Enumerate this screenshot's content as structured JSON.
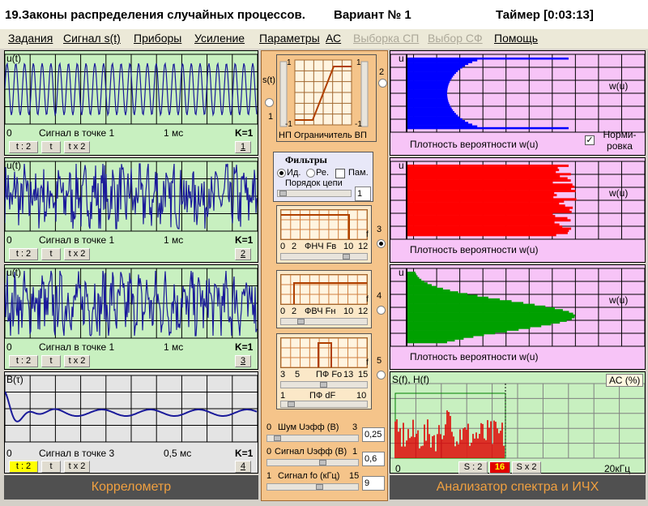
{
  "window": {
    "title": "19.Законы распределения случайных процессов.",
    "variant": "Вариант № 1",
    "timer": "Таймер [0:03:13]"
  },
  "menu": [
    "Задания",
    "Сигнал s(t)",
    "Приборы",
    "Усиление",
    "Параметры",
    "АС",
    "Выборка СП",
    "Выбор СФ",
    "Помощь"
  ],
  "left": {
    "axis_u": "u(t)",
    "axis_b": "B(τ)",
    "panels": [
      {
        "caption": "Сигнал в точке 1",
        "time": "1 мс",
        "k": "K=1",
        "zero": "0",
        "btn": [
          "t : 2",
          "t",
          "t x 2"
        ],
        "num": "1"
      },
      {
        "caption": "Сигнал в точке 1",
        "time": "1 мс",
        "k": "K=1",
        "zero": "0",
        "btn": [
          "t : 2",
          "t",
          "t x 2"
        ],
        "num": "2"
      },
      {
        "caption": "Сигнал в точке 1",
        "time": "1 мс",
        "k": "K=1",
        "zero": "0",
        "btn": [
          "t : 2",
          "t",
          "t x 2"
        ],
        "num": "3"
      },
      {
        "caption": "Сигнал в точке 3",
        "time": "0,5 мс",
        "k": "K=1",
        "zero": "0",
        "btn": [
          "t : 2",
          "t",
          "t x 2"
        ],
        "num": "4"
      }
    ],
    "footer": "Коррелометр"
  },
  "middle": {
    "limiter": {
      "label": "НП Ограничитель ВП",
      "st": "s(t)",
      "one": "1",
      "m1": "-1",
      "p1": "1",
      "p2": "1",
      "m2": "-1",
      "point2": "2"
    },
    "filters": {
      "title": "Фильтры",
      "id": "Ид.",
      "re": "Ре.",
      "pam": "Пам.",
      "order": "Порядок цепи",
      "order_val": "1"
    },
    "lpf": {
      "label": "ФНЧ Fв",
      "ticks": [
        "0",
        "2",
        "10",
        "12"
      ],
      "f": "f",
      "point": "3"
    },
    "hpf": {
      "label": "ФВЧ Fн",
      "ticks": [
        "0",
        "2",
        "10",
        "12"
      ],
      "f": "f",
      "point": "4"
    },
    "bpf": {
      "label": "ПФ Fо",
      "ticks": [
        "3",
        "5",
        "13",
        "15"
      ],
      "f": "f",
      "df": "ПФ dF",
      "df_ticks": [
        "1",
        "10"
      ],
      "point": "5"
    },
    "noise": {
      "label": "Шум Uэфф (В)",
      "min": "0",
      "max": "3",
      "val": "0,25"
    },
    "signal_u": {
      "label": "Сигнал Uэфф (В)",
      "min": "0",
      "max": "1",
      "val": "0,6"
    },
    "signal_f": {
      "label": "Сигнал fо (кГц)",
      "min": "1",
      "max": "15",
      "val": "9"
    }
  },
  "right": {
    "axis": "u",
    "wu": "w(u)",
    "caption": "Плотность вероятности  w(u)",
    "norm": "Норми- ровка",
    "spec": {
      "axis": "S(f), H(f)",
      "ac": "АС (%)",
      "zero": "0",
      "khz": "20кГц",
      "sd2": "S : 2",
      "num": "16",
      "sx2": "S x 2"
    },
    "footer": "Анализатор спектра и ИЧХ",
    "colors": [
      "#0000ff",
      "#ff0000",
      "#00a000"
    ]
  }
}
